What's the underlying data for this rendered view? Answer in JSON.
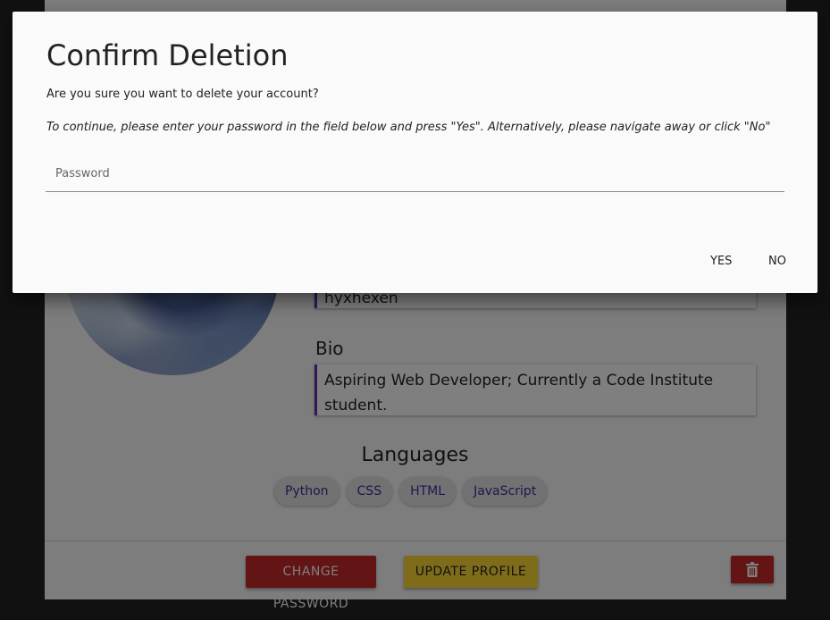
{
  "profile": {
    "username": "hyxhexen",
    "bio_label": "Bio",
    "bio": "Aspiring Web Developer; Currently a Code Institute student.",
    "languages_title": "Languages",
    "languages": [
      "Python",
      "CSS",
      "HTML",
      "JavaScript"
    ]
  },
  "footer": {
    "change_password": "CHANGE PASSWORD",
    "update_profile": "UPDATE PROFILE"
  },
  "colors": {
    "accent": "#5e35b1",
    "danger": "#c62828",
    "warning": "#fdd835",
    "chip_text": "#3f2f9f"
  },
  "icons": {
    "delete": "trash-icon"
  },
  "modal": {
    "title": "Confirm Deletion",
    "question": "Are you sure you want to delete your account?",
    "note": "To continue, please enter your password in the field below and press \"Yes\". Alternatively, please navigate away or click \"No\"",
    "password_placeholder": "Password",
    "password_value": "",
    "yes": "YES",
    "no": "NO"
  }
}
